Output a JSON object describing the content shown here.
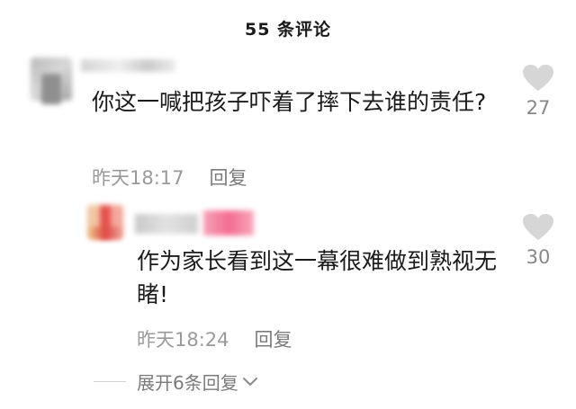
{
  "header": {
    "title": "55 条评论"
  },
  "comment": {
    "text": "你这一喊把孩子吓着了摔下去谁的责任?",
    "time": "昨天18:17",
    "reply_label": "回复",
    "likes": "27",
    "reply": {
      "text": "作为家长看到这一幕很难做到熟视无睹!",
      "time": "昨天18:24",
      "reply_label": "回复",
      "likes": "30"
    },
    "expand_label": "展开6条回复"
  },
  "colors": {
    "heart": "#d6d6d6",
    "meta_text": "#9a9a9a"
  },
  "icons": [
    "heart-icon",
    "chevron-down-icon"
  ]
}
